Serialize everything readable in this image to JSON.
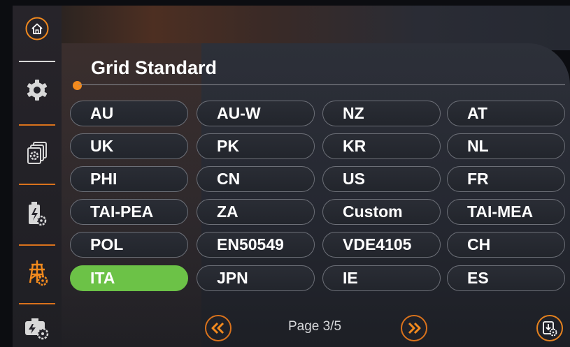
{
  "colors": {
    "accent": "#F28A1E",
    "selected": "#6CC247",
    "icon_default": "#D8D8D8"
  },
  "sidebar": {
    "items": [
      {
        "icon": "home-icon"
      },
      {
        "icon": "gear-icon"
      },
      {
        "icon": "device-settings-icon"
      },
      {
        "icon": "battery-settings-icon"
      },
      {
        "icon": "grid-settings-icon",
        "active": true
      },
      {
        "icon": "generator-settings-icon"
      }
    ]
  },
  "page": {
    "title": "Grid Standard"
  },
  "standards": [
    {
      "label": "AU"
    },
    {
      "label": "AU-W"
    },
    {
      "label": "NZ"
    },
    {
      "label": "AT"
    },
    {
      "label": "UK"
    },
    {
      "label": "PK"
    },
    {
      "label": "KR"
    },
    {
      "label": "NL"
    },
    {
      "label": "PHI"
    },
    {
      "label": "CN"
    },
    {
      "label": "US"
    },
    {
      "label": "FR"
    },
    {
      "label": "TAI-PEA"
    },
    {
      "label": "ZA"
    },
    {
      "label": "Custom"
    },
    {
      "label": "TAI-MEA"
    },
    {
      "label": "POL"
    },
    {
      "label": "EN50549"
    },
    {
      "label": "VDE4105"
    },
    {
      "label": "CH"
    },
    {
      "label": "ITA",
      "selected": true
    },
    {
      "label": "JPN"
    },
    {
      "label": "IE"
    },
    {
      "label": "ES"
    }
  ],
  "pager": {
    "label": "Page 3/5",
    "prev_icon": "double-chevron-left-icon",
    "next_icon": "double-chevron-right-icon"
  },
  "export": {
    "icon": "export-settings-icon"
  }
}
